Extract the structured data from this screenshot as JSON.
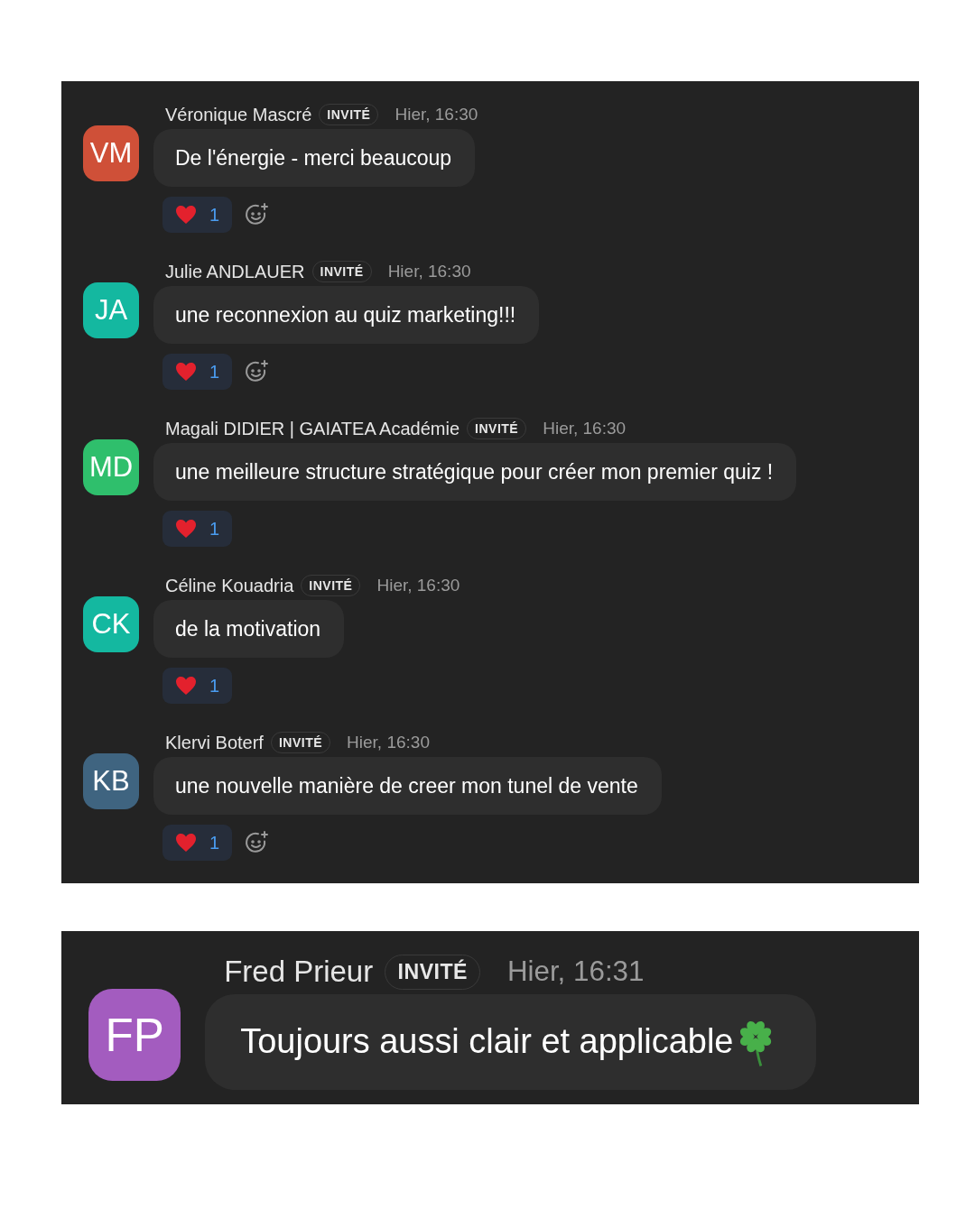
{
  "panels": [
    {
      "messages": [
        {
          "initials": "VM",
          "color": "#cf5038",
          "name": "Véronique Mascré",
          "badge": "INVITÉ",
          "time": "Hier, 16:30",
          "text": "De l'énergie - merci beaucoup",
          "reactions": [
            {
              "count": "1"
            }
          ],
          "add_reaction": true
        },
        {
          "initials": "JA",
          "color": "#14b8a0",
          "name": "Julie ANDLAUER",
          "badge": "INVITÉ",
          "time": "Hier, 16:30",
          "text": "une reconnexion au quiz marketing!!!",
          "reactions": [
            {
              "count": "1"
            }
          ],
          "add_reaction": true
        },
        {
          "initials": "MD",
          "color": "#2fbf6c",
          "name": "Magali DIDIER | GAIATEA Académie",
          "badge": "INVITÉ",
          "time": "Hier, 16:30",
          "text": "une meilleure structure stratégique pour créer mon premier quiz !",
          "reactions": [
            {
              "count": "1"
            }
          ],
          "add_reaction": false
        },
        {
          "initials": "CK",
          "color": "#14b8a0",
          "name": "Céline Kouadria",
          "badge": "INVITÉ",
          "time": "Hier, 16:30",
          "text": "de la motivation",
          "reactions": [
            {
              "count": "1"
            }
          ],
          "add_reaction": false
        },
        {
          "initials": "KB",
          "color": "#3f6480",
          "name": "Klervi Boterf",
          "badge": "INVITÉ",
          "time": "Hier, 16:30",
          "text": "une nouvelle manière de creer mon tunel de vente",
          "reactions": [
            {
              "count": "1"
            }
          ],
          "add_reaction": true
        }
      ]
    },
    {
      "messages": [
        {
          "initials": "FP",
          "color": "#a35cbf",
          "name": "Fred Prieur",
          "badge": "INVITÉ",
          "time": "Hier, 16:31",
          "text": "Toujours aussi clair et applicable",
          "kind": "with-clover",
          "add_reaction": false
        }
      ]
    }
  ]
}
